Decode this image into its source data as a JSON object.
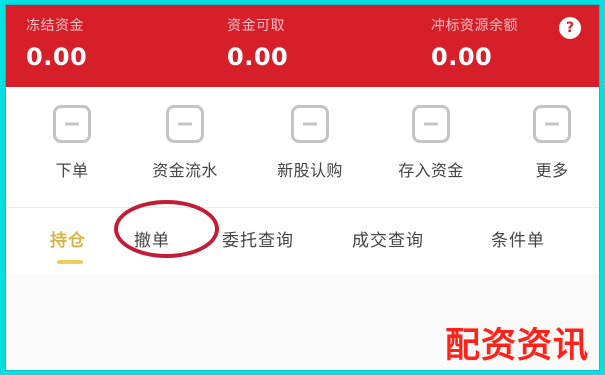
{
  "header": {
    "stats": [
      {
        "label": "冻结资金",
        "value": "0.00"
      },
      {
        "label": "资金可取",
        "value": "0.00"
      },
      {
        "label": "冲标资源余额",
        "value": "0.00"
      }
    ],
    "help_icon": "?"
  },
  "actions": [
    {
      "label": "下单",
      "icon": "download-icon"
    },
    {
      "label": "资金流水",
      "icon": "list-icon"
    },
    {
      "label": "新股认购",
      "icon": "new-icon"
    },
    {
      "label": "存入资金",
      "icon": "deposit-icon"
    },
    {
      "label": "更多",
      "icon": "grid-icon"
    }
  ],
  "tabs": [
    {
      "label": "持仓",
      "active": true
    },
    {
      "label": "撤单",
      "highlighted": true
    },
    {
      "label": "委托查询"
    },
    {
      "label": "成交查询"
    },
    {
      "label": "条件单"
    }
  ],
  "watermark": "配资资讯",
  "colors": {
    "header_bg": "#d71f2a",
    "frame_bg": "#00e0e0",
    "active_tab": "#d6b64a",
    "highlight": "#c31c36",
    "watermark": "#ff2219"
  }
}
